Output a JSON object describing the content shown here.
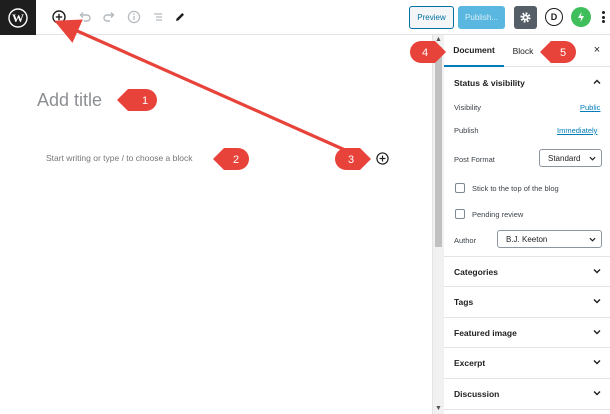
{
  "toolbar": {
    "preview_label": "Preview",
    "publish_label": "Publish...",
    "d_label": "D",
    "icons": [
      "wordpress-logo-icon",
      "add-block-icon",
      "undo-icon",
      "redo-icon",
      "info-icon",
      "outline-icon",
      "edit-tools-icon",
      "gear-icon",
      "jetpack-icon",
      "more-options-icon"
    ]
  },
  "editor": {
    "title_placeholder": "Add title",
    "block_placeholder": "Start writing or type / to choose a block"
  },
  "sidebar": {
    "tabs": [
      {
        "label": "Document"
      },
      {
        "label": "Block"
      }
    ],
    "close_label": "×",
    "status_panel": {
      "title": "Status & visibility",
      "visibility_label": "Visibility",
      "visibility_value": "Public",
      "publish_label": "Publish",
      "publish_value": "Immediately",
      "post_format_label": "Post Format",
      "post_format_value": "Standard",
      "sticky_label": "Stick to the top of the blog",
      "pending_label": "Pending review",
      "author_label": "Author",
      "author_value": "B.J. Keeton"
    },
    "panels": [
      {
        "title": "Categories"
      },
      {
        "title": "Tags"
      },
      {
        "title": "Featured image"
      },
      {
        "title": "Excerpt"
      },
      {
        "title": "Discussion"
      }
    ]
  },
  "annotations": {
    "badges": [
      "1",
      "2",
      "3",
      "4",
      "5"
    ],
    "color": "#e8433a"
  },
  "colors": {
    "accent": "#007cba",
    "publish": "#5ab7df",
    "settings_bg": "#555d66",
    "jetpack": "#3fbf5c"
  }
}
